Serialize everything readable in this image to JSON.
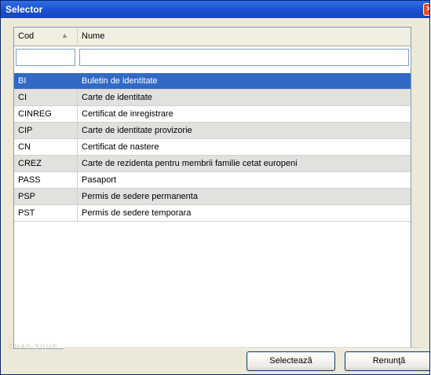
{
  "window": {
    "title": "Selector"
  },
  "grid": {
    "columns": {
      "code": "Cod",
      "name": "Nume"
    },
    "filter": {
      "code": "",
      "name": ""
    },
    "rows": [
      {
        "code": "BI",
        "name": "Buletin de identitate"
      },
      {
        "code": "CI",
        "name": "Carte de identitate"
      },
      {
        "code": "CINREG",
        "name": "Certificat de inregistrare"
      },
      {
        "code": "CIP",
        "name": "Carte de identitate provizorie"
      },
      {
        "code": "CN",
        "name": "Certificat de nastere"
      },
      {
        "code": "CREZ",
        "name": "Carte de rezidenta pentru membrii familie cetat europeni"
      },
      {
        "code": "PASS",
        "name": "Pasaport"
      },
      {
        "code": "PSP",
        "name": "Permis de sedere permanenta"
      },
      {
        "code": "PST",
        "name": "Permis de sedere temporara"
      }
    ],
    "selected_index": 0
  },
  "footer": {
    "brand": "CNAS-SIUI®",
    "select_label": "Selectează",
    "cancel_label": "Renunţă"
  },
  "colors": {
    "title_bar": "#1a4fcf",
    "selection": "#316ac5",
    "alt_row": "#e2e1dd"
  }
}
